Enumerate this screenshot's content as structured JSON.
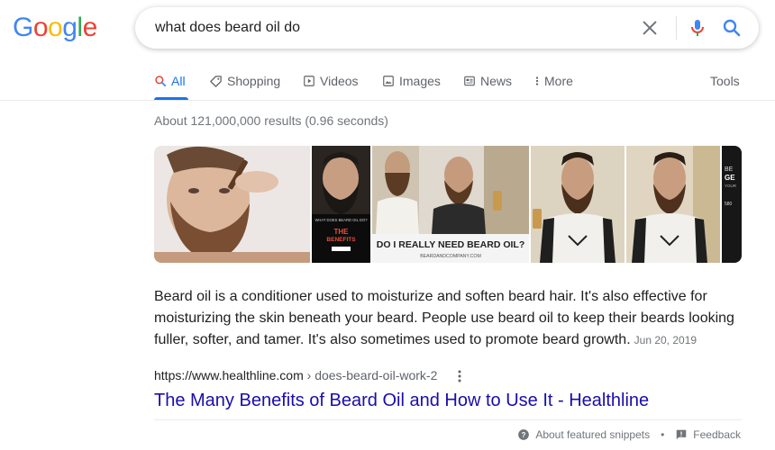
{
  "header": {
    "logo_letters": [
      {
        "ch": "G",
        "color": "#4285F4"
      },
      {
        "ch": "o",
        "color": "#EA4335"
      },
      {
        "ch": "o",
        "color": "#FBBC05"
      },
      {
        "ch": "g",
        "color": "#4285F4"
      },
      {
        "ch": "l",
        "color": "#34A853"
      },
      {
        "ch": "e",
        "color": "#EA4335"
      }
    ],
    "search_query": "what does beard oil do",
    "icons": [
      "clear-icon",
      "microphone-icon",
      "search-icon"
    ]
  },
  "tabs": [
    {
      "label": "All",
      "icon": "search-icon",
      "active": true
    },
    {
      "label": "Shopping",
      "icon": "tag-icon",
      "active": false
    },
    {
      "label": "Videos",
      "icon": "play-icon",
      "active": false
    },
    {
      "label": "Images",
      "icon": "image-icon",
      "active": false
    },
    {
      "label": "News",
      "icon": "news-icon",
      "active": false
    },
    {
      "label": "More",
      "icon": "more-vert-icon",
      "active": false
    }
  ],
  "tools_label": "Tools",
  "result_stats": "About 121,000,000 results (0.96 seconds)",
  "image_strip": {
    "thumb2_caption_top": "WHAT DOES BEARD OIL DO?",
    "thumb2_caption_main": "THE BENEFITS",
    "thumb3_caption_main": "DO I REALLY NEED BEARD OIL?",
    "thumb3_caption_sub": "BEARDANDCOMPANY.COM",
    "thumb6_caption_a": "BE",
    "thumb6_caption_b": "GE",
    "thumb6_caption_c": "YOUR",
    "thumb6_caption_d": "580"
  },
  "featured_snippet": {
    "text": "Beard oil is a conditioner used to moisturize and soften beard hair. It's also effective for moisturizing the skin beneath your beard. People use beard oil to keep their beards looking fuller, softer, and tamer. It's also sometimes used to promote beard growth.",
    "date": "Jun 20, 2019",
    "cite_domain": "https://www.healthline.com",
    "cite_path": " › does-beard-oil-work-2",
    "title": "The Many Benefits of Beard Oil and How to Use It - Healthline"
  },
  "footer": {
    "about_label": "About featured snippets",
    "separator": "•",
    "feedback_label": "Feedback"
  },
  "colors": {
    "link": "#1a0dab",
    "active_tab": "#1a73e8",
    "meta_text": "#70757a"
  }
}
